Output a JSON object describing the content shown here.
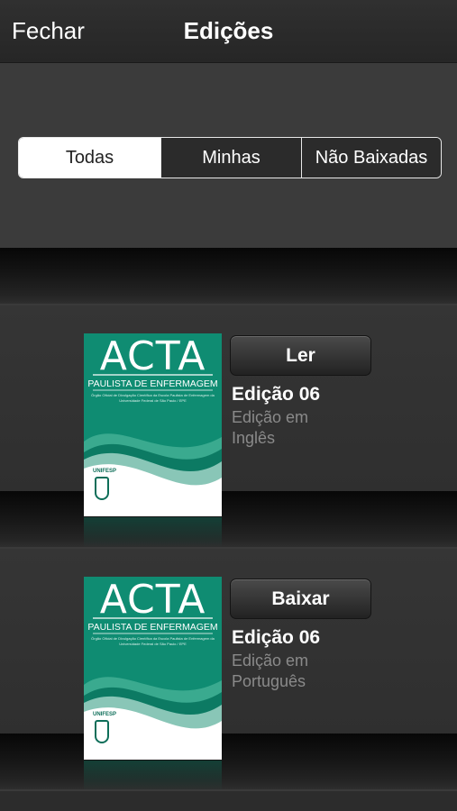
{
  "nav": {
    "close_label": "Fechar",
    "title": "Edições"
  },
  "filter": {
    "segments": [
      {
        "label": "Todas",
        "selected": true
      },
      {
        "label": "Minhas",
        "selected": false
      },
      {
        "label": "Não Baixadas",
        "selected": false
      }
    ]
  },
  "cover": {
    "logo": "ACTA",
    "subtitle": "PAULISTA DE ENFERMAGEM",
    "small_text": "Órgão Oficial de Divulgação Científica da Escola Paulista de Enfermagem da Universidade Federal de São Paulo / EPE",
    "seal_text": "UNIFESP",
    "color": "#0f8c72"
  },
  "editions": [
    {
      "button_label": "Ler",
      "title": "Edição 06",
      "description": "Edição em Inglês"
    },
    {
      "button_label": "Baixar",
      "title": "Edição 06",
      "description": "Edição em Português"
    }
  ]
}
